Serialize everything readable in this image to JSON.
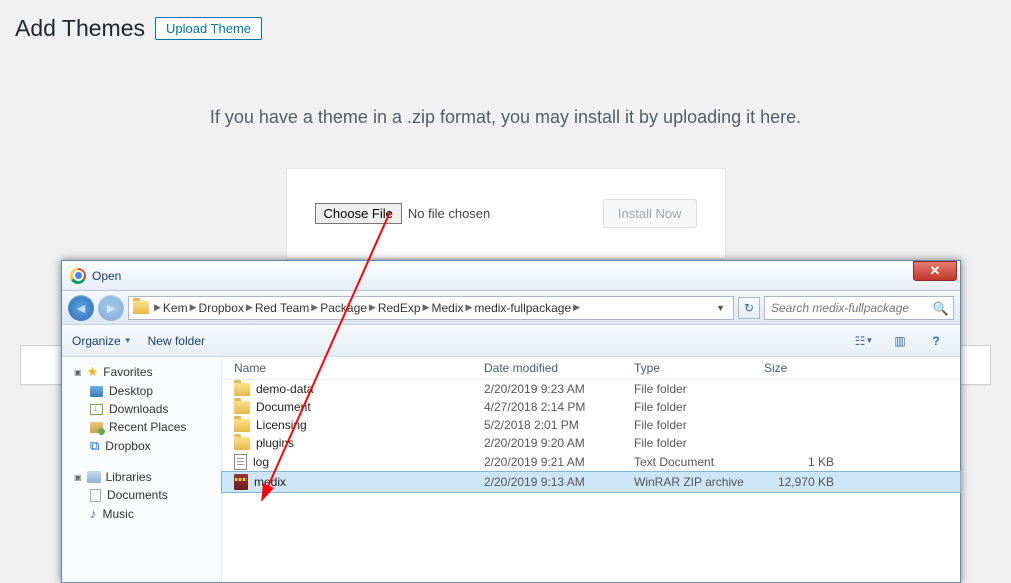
{
  "wp": {
    "title": "Add Themes",
    "upload_btn": "Upload Theme",
    "instruction": "If you have a theme in a .zip format, you may install it by uploading it here.",
    "choose_file": "Choose File",
    "no_file": "No file chosen",
    "install_now": "Install Now"
  },
  "dialog": {
    "title": "Open",
    "breadcrumb": [
      "Kem",
      "Dropbox",
      "Red Team",
      "Package",
      "RedExp",
      "Medix",
      "medix-fullpackage"
    ],
    "search_placeholder": "Search medix-fullpackage",
    "toolbar": {
      "organize": "Organize",
      "new_folder": "New folder"
    },
    "sidebar": {
      "favorites": {
        "label": "Favorites",
        "items": [
          "Desktop",
          "Downloads",
          "Recent Places",
          "Dropbox"
        ]
      },
      "libraries": {
        "label": "Libraries",
        "items": [
          "Documents",
          "Music"
        ]
      }
    },
    "columns": {
      "name": "Name",
      "date": "Date modified",
      "type": "Type",
      "size": "Size"
    },
    "rows": [
      {
        "icon": "folder",
        "name": "demo-data",
        "date": "2/20/2019 9:23 AM",
        "type": "File folder",
        "size": "",
        "selected": false
      },
      {
        "icon": "folder",
        "name": "Document",
        "date": "4/27/2018 2:14 PM",
        "type": "File folder",
        "size": "",
        "selected": false
      },
      {
        "icon": "folder",
        "name": "Licensing",
        "date": "5/2/2018 2:01 PM",
        "type": "File folder",
        "size": "",
        "selected": false
      },
      {
        "icon": "folder",
        "name": "plugins",
        "date": "2/20/2019 9:20 AM",
        "type": "File folder",
        "size": "",
        "selected": false
      },
      {
        "icon": "txt",
        "name": "log",
        "date": "2/20/2019 9:21 AM",
        "type": "Text Document",
        "size": "1 KB",
        "selected": false
      },
      {
        "icon": "zip",
        "name": "medix",
        "date": "2/20/2019 9:13 AM",
        "type": "WinRAR ZIP archive",
        "size": "12,970 KB",
        "selected": true
      }
    ]
  }
}
